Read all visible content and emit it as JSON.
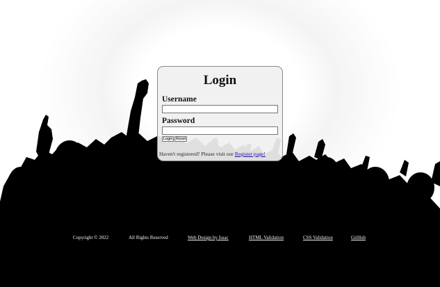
{
  "login": {
    "title": "Login",
    "username_label": "Username",
    "username_value": "",
    "password_label": "Password",
    "password_value": "",
    "login_button": "Login",
    "reset_button": "Reset",
    "register_prompt": "Haven't registered? Please visit our ",
    "register_link": "Register page!"
  },
  "footer": {
    "copyright": "Copyright © 2022",
    "rights": "All Rights Reserved",
    "web_design": "Web Design by Issac",
    "html_validation": "HTML Validation",
    "css_validation": "CSS Validation",
    "github": "GitHub"
  },
  "colors": {
    "background": "#000000",
    "card": "#f0f0f0",
    "link": "#1a0dab",
    "footer_text": "#f2f2f2"
  }
}
